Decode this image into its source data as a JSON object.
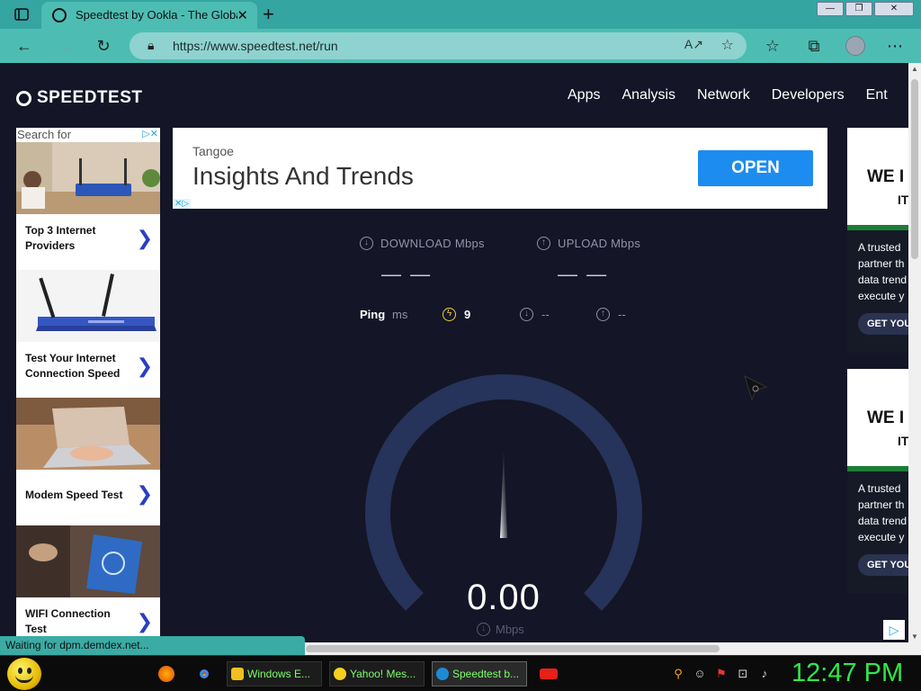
{
  "browser": {
    "tab_title": "Speedtest by Ookla - The Global",
    "tab_close": "✕",
    "new_tab": "+",
    "url": "https://www.speedtest.net/run",
    "win_min": "—",
    "win_max": "❐",
    "win_close": "✕"
  },
  "site": {
    "logo": "SPEEDTEST",
    "nav": [
      "Apps",
      "Analysis",
      "Network",
      "Developers",
      "Ent"
    ]
  },
  "left_ad": {
    "search_for": "Search for",
    "items": [
      {
        "label": "Top 3 Internet Providers"
      },
      {
        "label": "Test Your Internet Connection Speed"
      },
      {
        "label": "Modem Speed Test"
      },
      {
        "label": "WIFI Connection Test"
      }
    ],
    "chevron": "❯"
  },
  "top_ad": {
    "advertiser": "Tangoe",
    "headline": "Insights And Trends",
    "button": "OPEN"
  },
  "right_ad": {
    "headline": "WE I",
    "sub": "IT",
    "text": [
      "A trusted",
      "partner th",
      "data trend",
      "execute y"
    ],
    "button": "GET YOU"
  },
  "results": {
    "download_label": "DOWNLOAD Mbps",
    "upload_label": "UPLOAD Mbps",
    "download_value": "— —",
    "upload_value": "— —",
    "ping_label": "Ping",
    "ping_unit": "ms",
    "ping_value": "9",
    "jitter_down": "--",
    "jitter_up": "--"
  },
  "gauge": {
    "value": "0.00",
    "unit": "Mbps",
    "fraction": 0
  },
  "status": "Waiting for dpm.demdex.net...",
  "taskbar": {
    "items": [
      {
        "label": "Windows E...",
        "color": "#f0c020"
      },
      {
        "label": "Yahoo! Mes...",
        "color": "#f5d020"
      },
      {
        "label": "Speedtest b...",
        "color": "#1e8ad6"
      }
    ],
    "clock": "12:47 PM"
  },
  "colors": {
    "page_bg": "#141526",
    "chrome": "#4dbdb4",
    "accent_blue": "#1d8cf0",
    "clock_green": "#2ee84a",
    "gauge_track": "#26335a"
  }
}
